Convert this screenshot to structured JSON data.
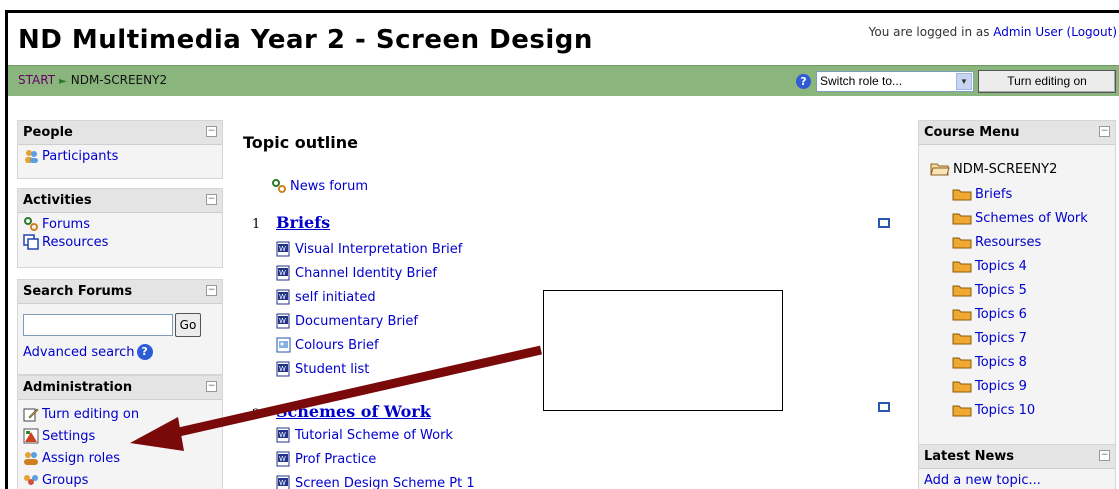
{
  "header": {
    "title": "ND Multimedia Year 2 - Screen Design",
    "login_prefix": "You are logged in as ",
    "user_name": "Admin User",
    "logout": "(Logout)"
  },
  "navbar": {
    "breadcrumb_start": "START",
    "breadcrumb_sep": "►",
    "breadcrumb_current": "NDM-SCREENY2",
    "help_glyph": "?",
    "role_select_value": "Switch role to...",
    "edit_button": "Turn editing on"
  },
  "left": {
    "people": {
      "title": "People",
      "items": [
        {
          "label": "Participants",
          "icon": "people-icon"
        }
      ]
    },
    "activities": {
      "title": "Activities",
      "items": [
        {
          "label": "Forums",
          "icon": "forum-icon"
        },
        {
          "label": "Resources",
          "icon": "resource-icon"
        }
      ]
    },
    "search": {
      "title": "Search Forums",
      "input_value": "",
      "go": "Go",
      "advanced": "Advanced search"
    },
    "admin": {
      "title": "Administration",
      "items": [
        {
          "label": "Turn editing on",
          "icon": "edit-icon"
        },
        {
          "label": "Settings",
          "icon": "settings-icon"
        },
        {
          "label": "Assign roles",
          "icon": "roles-icon"
        },
        {
          "label": "Groups",
          "icon": "groups-icon"
        }
      ]
    }
  },
  "main": {
    "title": "Topic outline",
    "news_forum": "News forum",
    "topics": [
      {
        "number": "1",
        "title": "Briefs",
        "items": [
          "Visual Interpretation Brief",
          "Channel Identity Brief",
          "self initiated",
          "Documentary Brief",
          "Colours Brief",
          "Student list"
        ]
      },
      {
        "number": "2",
        "title": "Schemes of Work",
        "items": [
          "Tutorial Scheme of Work",
          "Prof Practice",
          "Screen Design Scheme Pt 1"
        ]
      }
    ]
  },
  "right": {
    "course_menu": {
      "title": "Course Menu",
      "root": "NDM-SCREENY2",
      "items": [
        "Briefs",
        "Schemes of Work",
        "Resourses",
        "Topics 4",
        "Topics 5",
        "Topics 6",
        "Topics 7",
        "Topics 8",
        "Topics 9",
        "Topics 10"
      ]
    },
    "latest_news": {
      "title": "Latest News",
      "add": "Add a new topic..."
    }
  },
  "colors": {
    "navbar": "#8ab57d",
    "link": "#0000cc",
    "arrow": "#7a0a0a"
  }
}
